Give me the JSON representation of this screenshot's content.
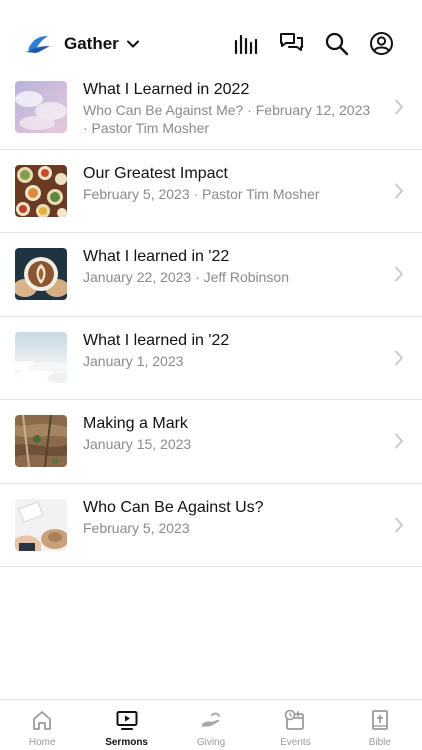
{
  "app": {
    "name": "Gather"
  },
  "header": {
    "icons": [
      "equalizer-icon",
      "chat-bubbles-icon",
      "search-icon",
      "profile-icon"
    ]
  },
  "sermons": [
    {
      "title": "What I Learned in 2022",
      "subtitle": "Who Can Be Against Me? · February 12, 2023 · Pastor Tim Mosher",
      "thumb_icon": "cloudy-sky-thumbnail"
    },
    {
      "title": "Our Greatest Impact",
      "subtitle": "February 5, 2023 · Pastor Tim Mosher",
      "thumb_icon": "food-table-thumbnail"
    },
    {
      "title": "What I learned in '22",
      "subtitle": "January 22, 2023 · Jeff Robinson",
      "thumb_icon": "latte-cup-thumbnail"
    },
    {
      "title": "What I learned in '22",
      "subtitle": "January 1, 2023",
      "thumb_icon": "sea-of-clouds-thumbnail"
    },
    {
      "title": "Making a Mark",
      "subtitle": "January 15, 2023",
      "thumb_icon": "aerial-terrain-thumbnail"
    },
    {
      "title": "Who Can Be Against Us?",
      "subtitle": "February 5, 2023",
      "thumb_icon": "desk-hat-thumbnail"
    }
  ],
  "tabs": [
    {
      "label": "Home",
      "icon": "home-icon",
      "active": false
    },
    {
      "label": "Sermons",
      "icon": "tv-play-icon",
      "active": true
    },
    {
      "label": "Giving",
      "icon": "giving-hand-icon",
      "active": false
    },
    {
      "label": "Events",
      "icon": "calendar-clock-icon",
      "active": false
    },
    {
      "label": "Bible",
      "icon": "bible-icon",
      "active": false
    }
  ],
  "colors": {
    "brand_blue": "#1e5aa8",
    "text": "#111111",
    "secondary_text": "#8a8a8a",
    "inactive_tab": "#9a9a9a",
    "divider": "#e6e6e6"
  }
}
